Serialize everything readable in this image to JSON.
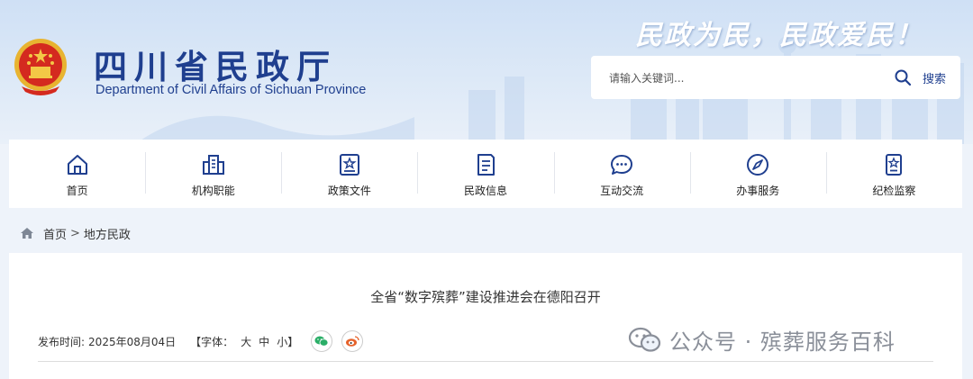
{
  "header": {
    "site_name": "四川省民政厅",
    "site_name_en": "Department of Civil Affairs of Sichuan Province",
    "slogan": "民政为民，民政爱民！",
    "search": {
      "placeholder": "请输入关键词...",
      "button_label": "搜索"
    }
  },
  "nav": {
    "items": [
      {
        "label": "首页",
        "icon": "home-icon"
      },
      {
        "label": "机构职能",
        "icon": "building-icon"
      },
      {
        "label": "政策文件",
        "icon": "policy-doc-icon"
      },
      {
        "label": "民政信息",
        "icon": "news-doc-icon"
      },
      {
        "label": "互动交流",
        "icon": "chat-icon"
      },
      {
        "label": "办事服务",
        "icon": "compass-icon"
      },
      {
        "label": "纪检监察",
        "icon": "badge-icon"
      }
    ]
  },
  "breadcrumb": {
    "home": "首页",
    "separator": ">",
    "current": "地方民政"
  },
  "article": {
    "title": "全省“数字殡葬”建设推进会在德阳召开",
    "publish_label": "发布时间:",
    "publish_date": "2025年08月04日",
    "font_size_label": "【字体：",
    "font_sizes": [
      "大",
      "中",
      "小"
    ],
    "font_size_close": "】",
    "share": {
      "wechat_icon": "wechat-icon",
      "weibo_icon": "weibo-icon"
    }
  },
  "watermark": {
    "text": "公众号 · 殡葬服务百科"
  },
  "colors": {
    "brand_blue": "#1f3f8f",
    "header_bg": "#d6e5f6",
    "page_bg": "#eef3fa",
    "wechat_green": "#2aae67",
    "weibo_orange": "#e6622a"
  }
}
